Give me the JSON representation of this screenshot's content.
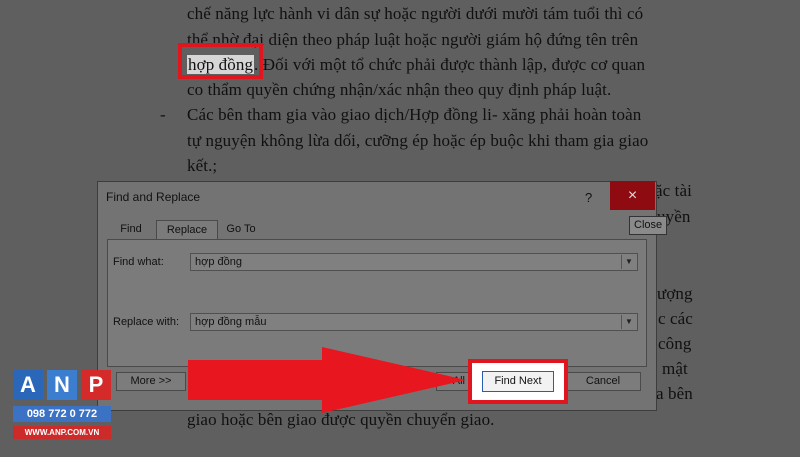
{
  "document": {
    "lines": [
      "chế năng lực hành vi dân sự hoặc người dưới mười tám tuổi thì có",
      "thể nhờ đại diện theo pháp luật hoặc người giám hộ đứng tên trên",
      "co thẩm quyền chứng nhận/xác nhận theo quy định pháp luật.",
      "tự nguyện không lừa dối, cưỡng ép hoặc ép buộc khi  tham gia giao",
      "kết.;",
      "giao hoặc bên giao được quyền chuyển giao."
    ],
    "highlight_term": "hợp đồng",
    "line3_rest": ". Đối với một tổ chức phải được thành lập, được cơ quan",
    "bullet_dash": "-",
    "bullet_line": "Các bên tham gia vào giao dịch/Hợp đồng li- xăng phải hoàn toàn",
    "right_fragments": [
      "ặc tài",
      "uyền",
      "ượng",
      "c các",
      "công",
      "mật",
      "a bên"
    ]
  },
  "dialog": {
    "title": "Find and Replace",
    "help": "?",
    "close_icon": "×",
    "close_tooltip": "Close",
    "tabs": [
      "Find",
      "Replace",
      "Go To"
    ],
    "find_label": "Find what:",
    "find_value": "hợp đồng",
    "replace_label": "Replace with:",
    "replace_value": "hợp đồng mẫu",
    "more_label": "More >>",
    "replace_all_fragment": "All",
    "find_next_label": "Find Next",
    "cancel_label": "Cancel"
  },
  "logo": {
    "letters": [
      "A",
      "N",
      "P"
    ],
    "phone": "098 772 0 772",
    "website": "WWW.ANP.COM.VN"
  },
  "colors": {
    "highlight_box": "#e0161f",
    "arrow": "#e8161f",
    "close_button": "#8e0c11"
  }
}
